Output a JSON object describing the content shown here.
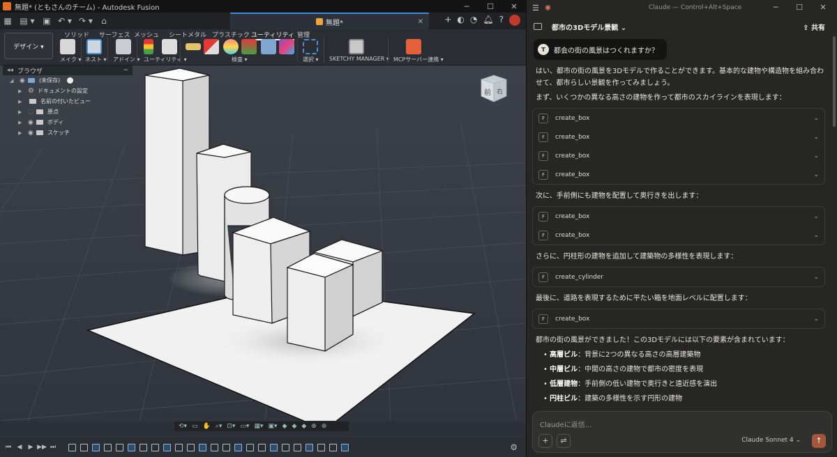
{
  "fusion": {
    "title": "無題* (ともさんのチーム) - Autodesk Fusion",
    "doc_tab": "無題*",
    "workspace": "デザイン ▾",
    "ribbon_tabs": [
      "ソリッド",
      "サーフェス",
      "メッシュ",
      "シートメタル",
      "プラスチック",
      "ユーティリティ",
      "管理"
    ],
    "active_tab": "ユーティリティ",
    "groups": {
      "make": "メイク ▾",
      "nest": "ネスト ▾",
      "addin": "アドイン ▾",
      "utility": "ユーティリティ ▾",
      "inspect": "検査 ▾",
      "select": "選択 ▾",
      "sketchy": "SKETCHY MANAGER ▾",
      "mcp": "MCPサーバー連携 ▾"
    },
    "browser": {
      "title": "ブラウザ",
      "root": "(未保存)",
      "items": [
        "ドキュメントの設定",
        "名前の付いたビュー",
        "原点",
        "ボディ",
        "スケッチ"
      ]
    },
    "viewcube": {
      "front": "前",
      "right": "右"
    }
  },
  "claude": {
    "window_title": "Claude — Control+Alt+Space",
    "conversation_title": "都市の3Dモデル景観 ⌄",
    "share": "共有",
    "user_initial": "T",
    "user_message": "都会の街の風景はつくれますか？",
    "intro": "はい、都市の街の風景を3Dモデルで作ることができます。基本的な建物や構造物を組み合わせて、都市らしい景観を作ってみましょう。",
    "step1": "まず、いくつかの異なる高さの建物を作って都市のスカイラインを表現します：",
    "group1": [
      "create_box",
      "create_box",
      "create_box",
      "create_box"
    ],
    "step2": "次に、手前側にも建物を配置して奥行きを出します：",
    "group2": [
      "create_box",
      "create_box"
    ],
    "step3": "さらに、円柱形の建物を追加して建築物の多様性を表現します：",
    "group3": [
      "create_cylinder"
    ],
    "step4": "最後に、道路を表現するために平たい箱を地面レベルに配置します：",
    "group4": [
      "create_box"
    ],
    "summary": "都市の街の風景ができました！この3Dモデルには以下の要素が含まれています：",
    "bullets": [
      {
        "term": "高層ビル",
        "desc": "：背景に2つの異なる高さの高層建築物"
      },
      {
        "term": "中層ビル",
        "desc": "：中間の高さの建物で都市の密度を表現"
      },
      {
        "term": "低層建物",
        "desc": "：手前側の低い建物で奥行きと遠近感を演出"
      },
      {
        "term": "円柱ビル",
        "desc": "：建築の多様性を示す円形の建物"
      }
    ],
    "input_placeholder": "Claudeに返信...",
    "model": "Claude Sonnet 4 ⌄"
  }
}
